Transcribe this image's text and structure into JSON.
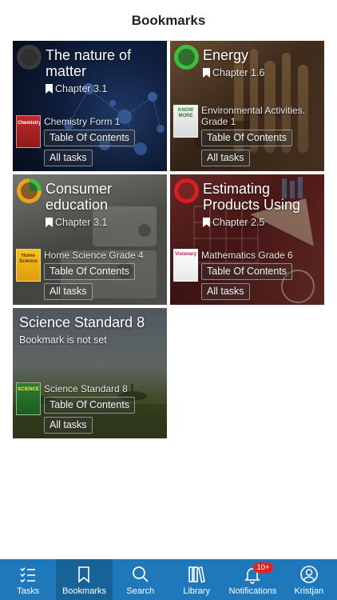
{
  "header": {
    "title": "Bookmarks"
  },
  "cards": [
    {
      "title": "The nature of matter",
      "chapter": "Chapter 3.1",
      "book": "Chemistry Form 1",
      "thumb_text": "Chemistry",
      "toc": "Table Of Contents",
      "tasks": "All tasks",
      "ring_color": "#3a3a3a",
      "theme": "molecules"
    },
    {
      "title": "Energy",
      "chapter": "Chapter 1.6",
      "book": "Environmental Activities. Grade 1",
      "thumb_text": "KNOW MORE",
      "toc": "Table Of Contents",
      "tasks": "All tasks",
      "ring_color": "#3cbf3c",
      "theme": "wood"
    },
    {
      "title": "Consumer education",
      "chapter": "Chapter 3.1",
      "book": "Home Science Grade 4",
      "thumb_text": "Home Science",
      "toc": "Table Of Contents",
      "tasks": "All tasks",
      "ring_color": "#f0a020",
      "theme": "market"
    },
    {
      "title": "Estimating Products Using",
      "chapter": "Chapter 2.5",
      "book": "Mathematics Grade 6",
      "thumb_text": "Visionary",
      "toc": "Table Of Contents",
      "tasks": "All tasks",
      "ring_color": "#d62020",
      "theme": "math"
    },
    {
      "title": "Science Standard 8",
      "subtitle": "Bookmark is not set",
      "book": "Science Standard 8",
      "thumb_text": "SCIENCE",
      "toc": "Table Of Contents",
      "tasks": "All tasks",
      "theme": "savanna"
    }
  ],
  "tabs": [
    {
      "label": "Tasks",
      "icon": "tasks-icon"
    },
    {
      "label": "Bookmarks",
      "icon": "bookmark-icon",
      "active": true
    },
    {
      "label": "Search",
      "icon": "search-icon"
    },
    {
      "label": "Library",
      "icon": "library-icon"
    },
    {
      "label": "Notifications",
      "icon": "bell-icon",
      "badge": "10+"
    },
    {
      "label": "Kristjan",
      "icon": "user-icon"
    }
  ]
}
